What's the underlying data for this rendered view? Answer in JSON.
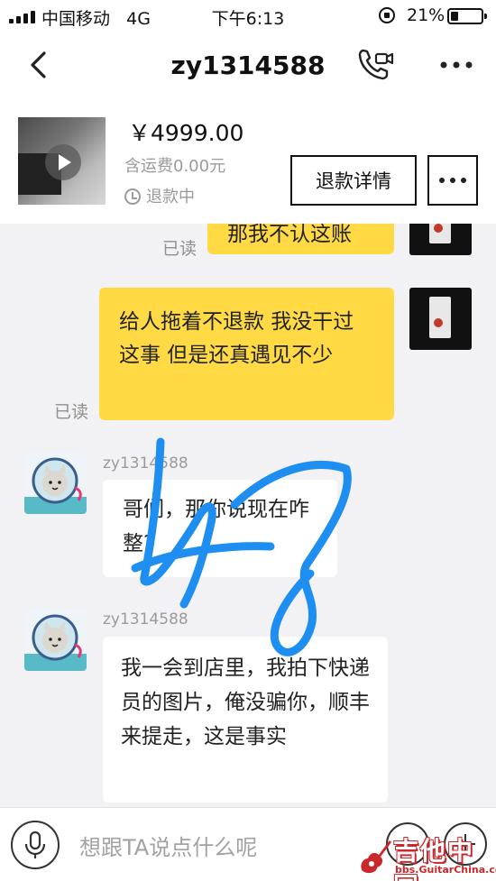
{
  "status_bar": {
    "carrier": "中国移动",
    "network": "4G",
    "time": "下午6:13",
    "battery": "21%",
    "battery_level": 0.21
  },
  "nav": {
    "title": "zy1314588",
    "back_icon": "chevron-left-icon",
    "call_icon": "phone-video-icon",
    "more_icon": "more-dots-icon"
  },
  "product": {
    "price": "￥4999.00",
    "shipping": "含运费0.00元",
    "status": "退款中",
    "refund_button": "退款详情",
    "more_button_icon": "more-dots-icon"
  },
  "messages": {
    "m1": {
      "text": "那我不认这账",
      "read": "已读"
    },
    "m2": {
      "text": "给人拖着不退款 我没干过这事 但是还真遇见不少",
      "read": "已读"
    },
    "m3": {
      "sender": "zy1314588",
      "text": "哥们，那你说现在咋整?"
    },
    "m4": {
      "sender": "zy1314588",
      "text": "我一会到店里，我拍下快递员的图片，俺没骗你，顺丰来提走，这是事实"
    }
  },
  "input": {
    "placeholder": "想跟TA说点什么呢",
    "mic_icon": "microphone-icon",
    "emoji_icon": "emoji-icon",
    "plus_icon": "plus-icon"
  },
  "watermark": {
    "text": "吉他中国",
    "url": "bbs.GuitarChina.com"
  },
  "colors": {
    "my_bubble": "#ffda44",
    "background": "#f2f2f4",
    "scribble": "#1e8ff0",
    "watermark": "#c9282d"
  }
}
